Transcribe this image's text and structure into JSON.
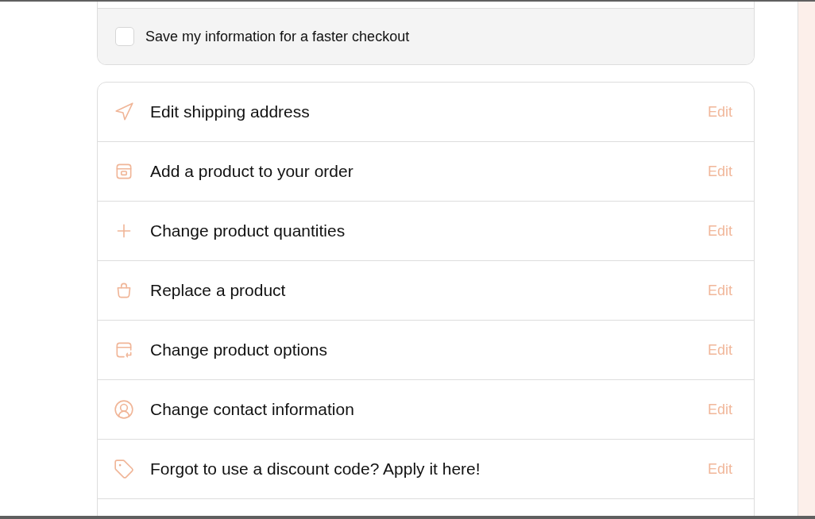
{
  "save_info": {
    "label": "Save my information for a faster checkout",
    "checked": false
  },
  "actions": [
    {
      "label": "Edit shipping address",
      "link": "Edit"
    },
    {
      "label": "Add a product to your order",
      "link": "Edit"
    },
    {
      "label": "Change product quantities",
      "link": "Edit"
    },
    {
      "label": "Replace a product",
      "link": "Edit"
    },
    {
      "label": "Change product options",
      "link": "Edit"
    },
    {
      "label": "Change contact information",
      "link": "Edit"
    },
    {
      "label": "Forgot to use a discount code? Apply it here!",
      "link": "Edit"
    }
  ]
}
